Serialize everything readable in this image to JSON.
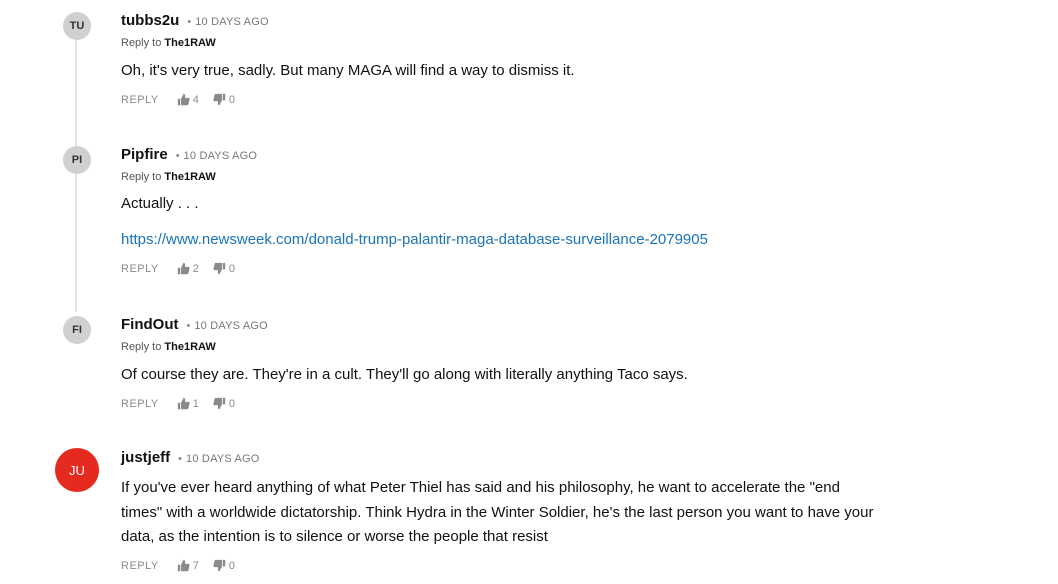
{
  "comments": [
    {
      "avatar": "TU",
      "author": "tubbs2u",
      "separator": "•",
      "time": "10 DAYS AGO",
      "reply_prefix": "Reply to",
      "reply_to": "The1RAW",
      "text": "Oh, it's very true, sadly. But many MAGA will find a way to dismiss it.",
      "reply_label": "REPLY",
      "likes": "4",
      "dislikes": "0"
    },
    {
      "avatar": "PI",
      "author": "Pipfire",
      "separator": "•",
      "time": "10 DAYS AGO",
      "reply_prefix": "Reply to",
      "reply_to": "The1RAW",
      "text": "Actually . . .",
      "link": "https://www.newsweek.com/donald-trump-palantir-maga-database-surveillance-2079905",
      "reply_label": "REPLY",
      "likes": "2",
      "dislikes": "0"
    },
    {
      "avatar": "FI",
      "author": "FindOut",
      "separator": "•",
      "time": "10 DAYS AGO",
      "reply_prefix": "Reply to",
      "reply_to": "The1RAW",
      "text": "Of course they are. They're in a cult. They'll go along with literally anything Taco says.",
      "reply_label": "REPLY",
      "likes": "1",
      "dislikes": "0"
    },
    {
      "avatar": "JU",
      "avatar_color": "#e52b1f",
      "author": "justjeff",
      "separator": "•",
      "time": "10 DAYS AGO",
      "text_lines": [
        "If you've ever heard anything of what Peter Thiel has said and his philosophy, he want to accelerate the \"end",
        "times\" with a worldwide dictatorship. Think Hydra in the Winter Soldier, he's the last person you want to have your",
        "data, as the intention is to silence or worse the people that resist"
      ],
      "reply_label": "REPLY",
      "likes": "7",
      "dislikes": "0"
    }
  ],
  "icons": {
    "like": "thumbs-up-icon",
    "dislike": "thumbs-down-icon"
  },
  "colors": {
    "link": "#1a73b8",
    "avatar_default": "#d0d0d0",
    "avatar_red": "#e52b1f"
  }
}
